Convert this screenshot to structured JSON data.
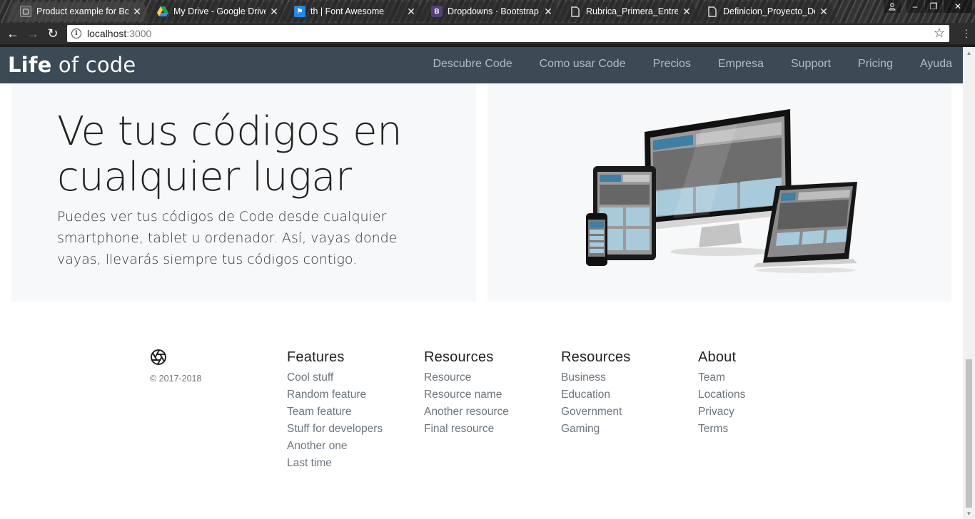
{
  "browser": {
    "tabs": [
      {
        "title": "Product example for Boo",
        "favicon": "bootstrap-page-icon",
        "active": true
      },
      {
        "title": "My Drive - Google Drive",
        "favicon": "google-drive-icon",
        "active": false
      },
      {
        "title": "th | Font Awesome",
        "favicon": "font-awesome-flag-icon",
        "active": false
      },
      {
        "title": "Dropdowns · Bootstrap",
        "favicon": "bootstrap-b-icon",
        "active": false
      },
      {
        "title": "Rubrica_Primera_Entrega",
        "favicon": "document-icon",
        "active": false
      },
      {
        "title": "Definicion_Proyecto_Des",
        "favicon": "document-icon",
        "active": false
      }
    ],
    "url_host": "localhost",
    "url_port": ":3000"
  },
  "site": {
    "brand_bold": "Life",
    "brand_rest": " of code",
    "nav": [
      "Descubre Code",
      "Como usar Code",
      "Precios",
      "Empresa",
      "Support",
      "Pricing",
      "Ayuda"
    ]
  },
  "hero": {
    "title": "Ve tus códigos en cualquier lugar",
    "text": "Puedes ver tus códigos de Code desde cualquier smartphone, tablet u ordenador. Así, vayas donde vayas, llevarás siempre tus códigos contigo."
  },
  "footer": {
    "copyright": "© 2017-2018",
    "columns": [
      {
        "title": "Features",
        "items": [
          "Cool stuff",
          "Random feature",
          "Team feature",
          "Stuff for developers",
          "Another one",
          "Last time"
        ]
      },
      {
        "title": "Resources",
        "items": [
          "Resource",
          "Resource name",
          "Another resource",
          "Final resource"
        ]
      },
      {
        "title": "Resources",
        "items": [
          "Business",
          "Education",
          "Government",
          "Gaming"
        ]
      },
      {
        "title": "About",
        "items": [
          "Team",
          "Locations",
          "Privacy",
          "Terms"
        ]
      }
    ]
  },
  "colors": {
    "navbar": "#3b4a54",
    "panel": "#f7f8f9",
    "muted_text": "#6c757d"
  }
}
